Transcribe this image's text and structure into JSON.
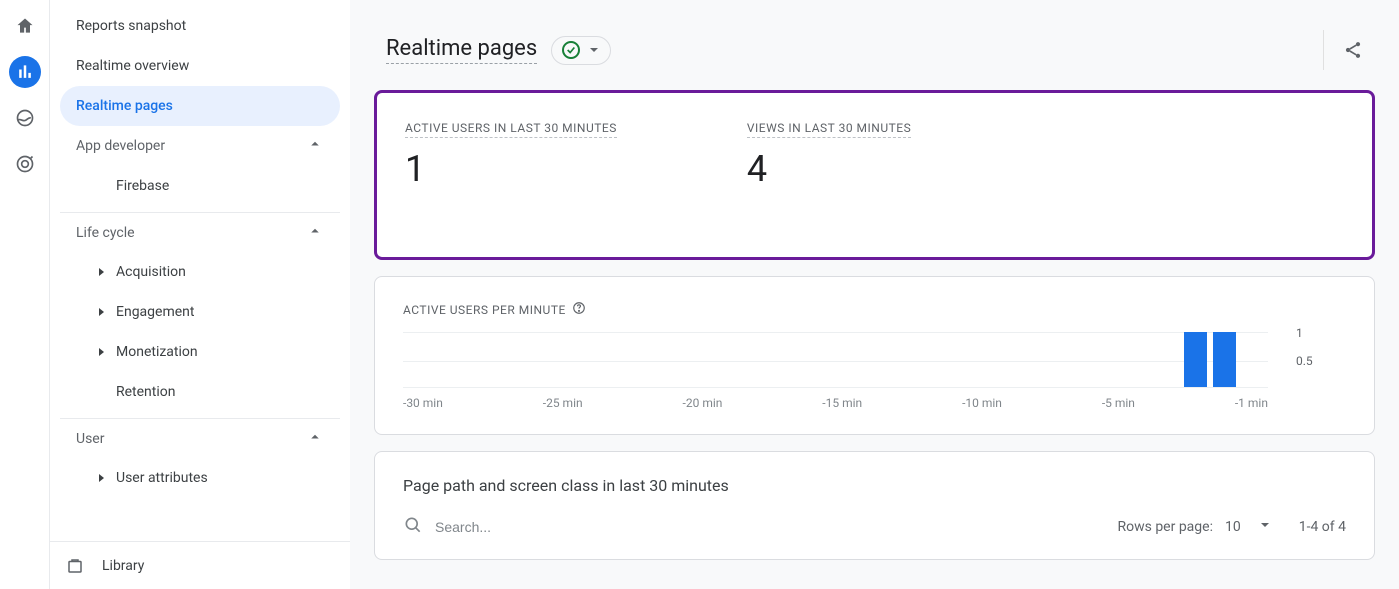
{
  "rail": {
    "items": [
      "home",
      "reports",
      "explore",
      "advertising"
    ]
  },
  "sidebar": {
    "top": [
      {
        "label": "Reports snapshot"
      },
      {
        "label": "Realtime overview"
      },
      {
        "label": "Realtime pages",
        "selected": true
      }
    ],
    "groups": [
      {
        "label": "App developer",
        "items": [
          {
            "label": "Firebase"
          }
        ]
      },
      {
        "label": "Life cycle",
        "items": [
          {
            "label": "Acquisition",
            "expandable": true
          },
          {
            "label": "Engagement",
            "expandable": true
          },
          {
            "label": "Monetization",
            "expandable": true
          },
          {
            "label": "Retention"
          }
        ]
      },
      {
        "label": "User",
        "items": [
          {
            "label": "User attributes",
            "expandable": true
          }
        ]
      }
    ],
    "library_label": "Library"
  },
  "header": {
    "title": "Realtime pages"
  },
  "metrics": {
    "active_users_label": "ACTIVE USERS IN LAST 30 MINUTES",
    "active_users_value": "1",
    "views_label": "VIEWS IN LAST 30 MINUTES",
    "views_value": "4"
  },
  "spark": {
    "label": "ACTIVE USERS PER MINUTE",
    "y_ticks": [
      "1",
      "0.5"
    ],
    "x_ticks": [
      "-30 min",
      "-25 min",
      "-20 min",
      "-15 min",
      "-10 min",
      "-5 min",
      "-1 min"
    ]
  },
  "chart_data": {
    "type": "bar",
    "title": "Active users per minute",
    "xlabel": "",
    "ylabel": "",
    "ylim": [
      0,
      1
    ],
    "categories": [
      -30,
      -29,
      -28,
      -27,
      -26,
      -25,
      -24,
      -23,
      -22,
      -21,
      -20,
      -19,
      -18,
      -17,
      -16,
      -15,
      -14,
      -13,
      -12,
      -11,
      -10,
      -9,
      -8,
      -7,
      -6,
      -5,
      -4,
      -3,
      -2,
      -1
    ],
    "values": [
      0,
      0,
      0,
      0,
      0,
      0,
      0,
      0,
      0,
      0,
      0,
      0,
      0,
      0,
      0,
      0,
      0,
      0,
      0,
      0,
      0,
      0,
      0,
      0,
      0,
      0,
      0,
      1,
      1,
      0
    ],
    "x_tick_labels": [
      "-30 min",
      "-25 min",
      "-20 min",
      "-15 min",
      "-10 min",
      "-5 min",
      "-1 min"
    ],
    "y_tick_labels": [
      "0.5",
      "1"
    ]
  },
  "table": {
    "title": "Page path and screen class in last 30 minutes",
    "search_placeholder": "Search...",
    "rows_per_page_label": "Rows per page:",
    "rows_per_page_value": "10",
    "range_label": "1-4 of 4"
  }
}
